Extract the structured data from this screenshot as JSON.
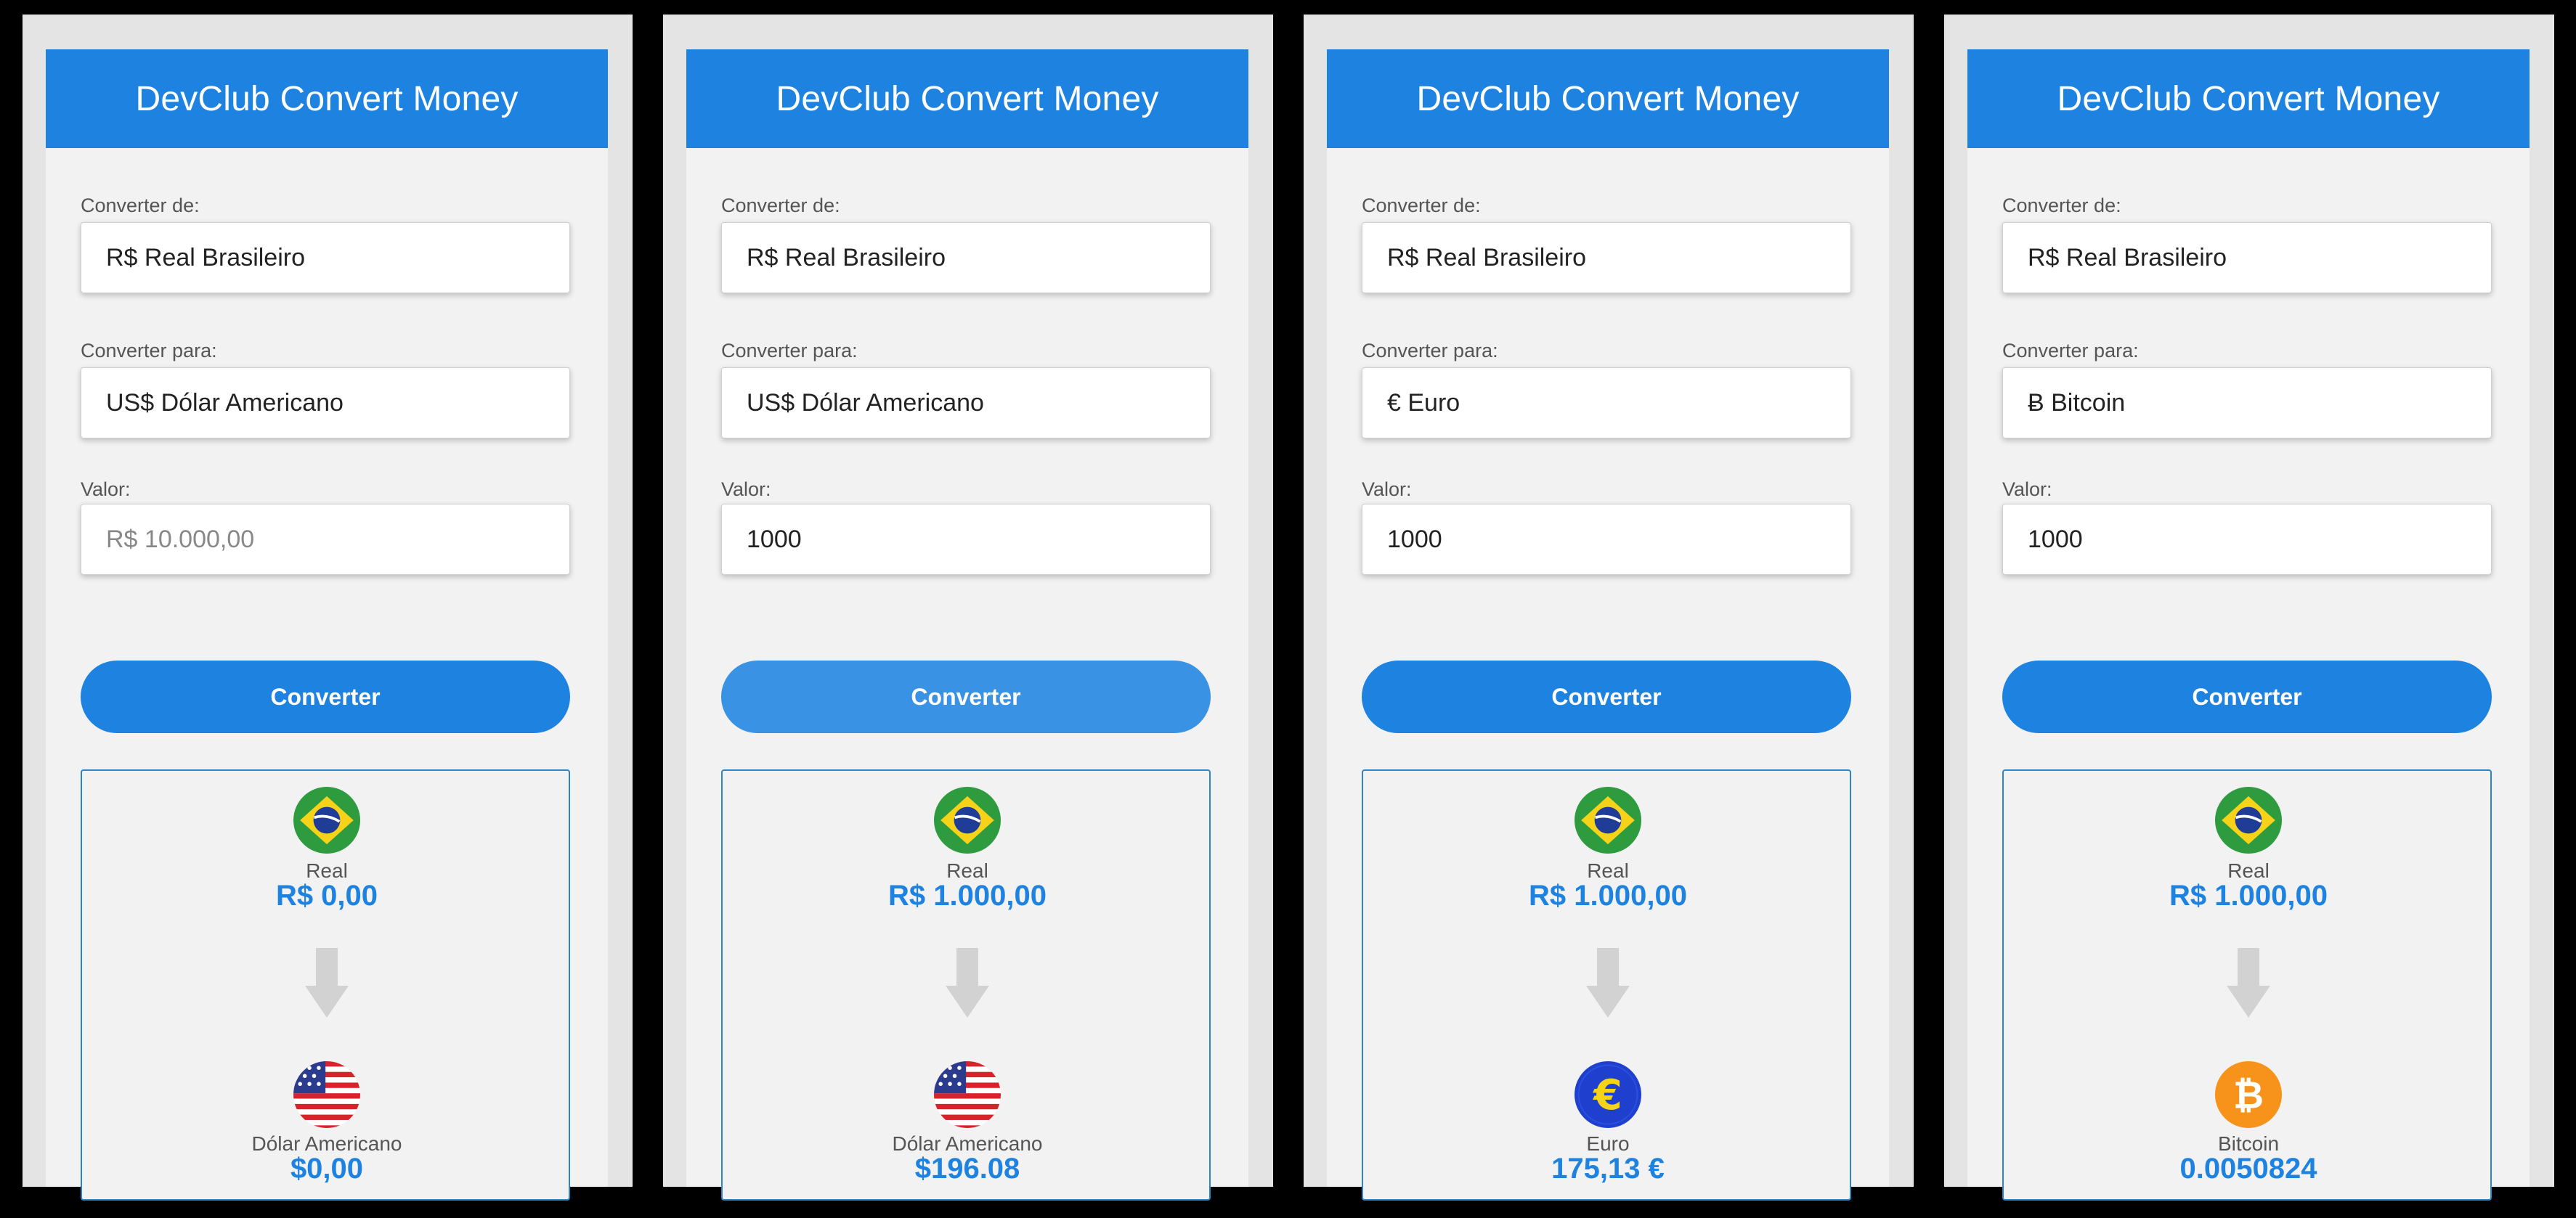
{
  "panels": [
    {
      "title": "DevClub Convert Money",
      "from_label": "Converter de:",
      "from_value": "R$ Real Brasileiro",
      "to_label": "Converter para:",
      "to_value": "US$ Dólar Americano",
      "amount_label": "Valor:",
      "amount_value": "",
      "amount_placeholder": "R$ 10.000,00",
      "button_label": "Converter",
      "source": {
        "icon": "brazil-flag-icon",
        "name": "Real",
        "value": "R$ 0,00"
      },
      "target": {
        "icon": "usa-flag-icon",
        "name": "Dólar Americano",
        "value": "$0,00"
      }
    },
    {
      "title": "DevClub Convert Money",
      "from_label": "Converter de:",
      "from_value": "R$ Real Brasileiro",
      "to_label": "Converter para:",
      "to_value": "US$ Dólar Americano",
      "amount_label": "Valor:",
      "amount_value": "1000",
      "amount_placeholder": "R$ 10.000,00",
      "button_label": "Converter",
      "source": {
        "icon": "brazil-flag-icon",
        "name": "Real",
        "value": "R$ 1.000,00"
      },
      "target": {
        "icon": "usa-flag-icon",
        "name": "Dólar Americano",
        "value": "$196.08"
      }
    },
    {
      "title": "DevClub Convert Money",
      "from_label": "Converter de:",
      "from_value": "R$ Real Brasileiro",
      "to_label": "Converter para:",
      "to_value": "€ Euro",
      "amount_label": "Valor:",
      "amount_value": "1000",
      "amount_placeholder": "R$ 10.000,00",
      "button_label": "Converter",
      "source": {
        "icon": "brazil-flag-icon",
        "name": "Real",
        "value": "R$ 1.000,00"
      },
      "target": {
        "icon": "euro-icon",
        "name": "Euro",
        "value": "175,13 €"
      }
    },
    {
      "title": "DevClub Convert Money",
      "from_label": "Converter de:",
      "from_value": "R$ Real Brasileiro",
      "to_label": "Converter para:",
      "to_value": "Ƀ Bitcoin",
      "amount_label": "Valor:",
      "amount_value": "1000",
      "amount_placeholder": "R$ 10.000,00",
      "button_label": "Converter",
      "source": {
        "icon": "brazil-flag-icon",
        "name": "Real",
        "value": "R$ 1.000,00"
      },
      "target": {
        "icon": "bitcoin-icon",
        "name": "Bitcoin",
        "value": "0.0050824"
      }
    }
  ],
  "colors": {
    "accent": "#1e83e0",
    "button_hover": "#3a92e4",
    "card_bg": "#f2f2f2",
    "result_border": "#2a86c8",
    "frame": "#000000"
  }
}
